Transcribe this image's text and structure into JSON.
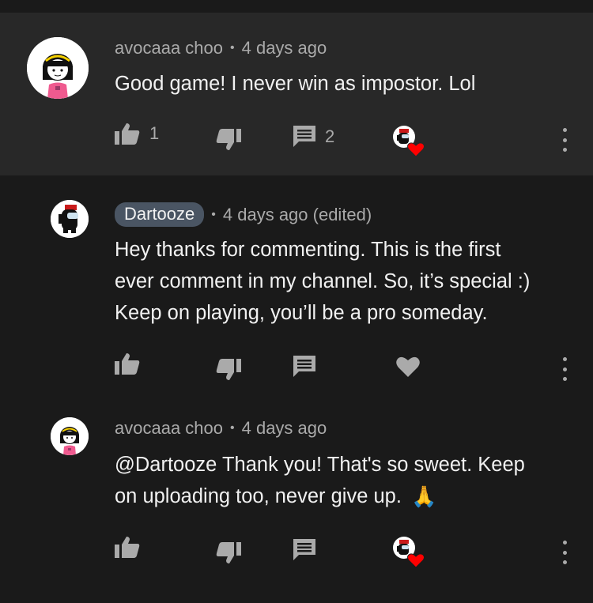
{
  "comments": [
    {
      "author": "avocaaa choo",
      "time": "4 days ago",
      "text_lines": [
        "Good game! I never win as impostor. Lol"
      ],
      "like_count": "1",
      "reply_count": "2",
      "hearted": true
    },
    {
      "author": "Dartooze",
      "author_is_creator": true,
      "time": "4 days ago (edited)",
      "text_lines": [
        "Hey thanks for commenting. This is the first",
        "ever comment in my channel. So, it’s special :)",
        "Keep on playing, you’ll be a pro someday."
      ],
      "like_count": "",
      "hearted": false
    },
    {
      "author": "avocaaa choo",
      "time": "4 days ago",
      "text_lines": [
        "@Dartooze Thank you! That's so sweet. Keep",
        "on uploading too, never give up."
      ],
      "emoji": "🙏",
      "like_count": "",
      "hearted": true
    }
  ],
  "icons": {
    "like": "thumbs-up-icon",
    "dislike": "thumbs-down-icon",
    "reply": "comment-icon",
    "heart": "heart-icon",
    "more": "more-vertical-icon"
  },
  "colors": {
    "background": "#1a1a1a",
    "top_comment_background": "#282828",
    "creator_chip": "#4a5563",
    "heart": "#ff0000",
    "secondary_text": "#aaaaaa"
  }
}
